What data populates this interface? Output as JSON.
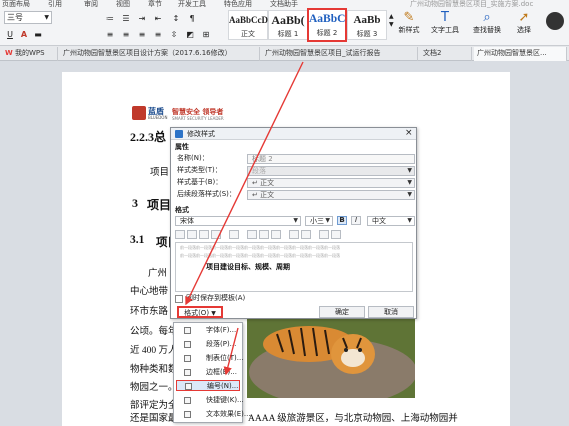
{
  "ribbon": {
    "tabs": [
      "页面布局",
      "引用",
      "审阅",
      "视图",
      "章节",
      "开发工具",
      "特色应用",
      "文档助手"
    ],
    "doc_title": "广州动物园智慧景区项目_实施方案.doc",
    "font_size_value": "三号",
    "styles": [
      {
        "preview": "AaBbCcDd",
        "label": "正文"
      },
      {
        "preview": "AaBb(",
        "label": "标题 1"
      },
      {
        "preview": "AaBbC",
        "label": "标题 2"
      },
      {
        "preview": "AaBb",
        "label": "标题 3"
      }
    ],
    "new_style_label": "新样式",
    "text_tools_label": "文字工具",
    "find_replace_label": "查找替换",
    "select_label": "选择"
  },
  "doc_tabs": [
    "我的WPS",
    "广州动物园智慧景区项目设计方案（2017.6.16修改）",
    "广州动物园智慧景区项目_试运行报告",
    "文档2",
    "广州动物园智慧景区..."
  ],
  "document": {
    "brand_name": "蓝盾",
    "brand_sub": "BLUEDON",
    "slogan": "智慧安全 领导者",
    "slogan_sub": "SMART SECURITY LEADER",
    "h_223": "2.2.3总",
    "p_project": "项目",
    "h_3": "3",
    "h_3_text": "项目",
    "h_31": "3.1",
    "h_31_text": "项目",
    "lines": [
      "广州",
      "中心地带",
      "环市东路",
      "公顷。每年",
      "近 400 万人",
      "物种类和数",
      "物园之一。",
      "部评定为全",
      "还是国家最"
    ],
    "bottom_tail": "AAAA 级旅游景区，与北京动物园、上海动物园并"
  },
  "dialog": {
    "title": "修改样式",
    "section_props": "属性",
    "name_label": "名称(N)：",
    "name_value": "标题 2",
    "type_label": "样式类型(T)：",
    "type_value": "段落",
    "based_label": "样式基于(B)：",
    "based_value": "↵ 正文",
    "next_label": "后续段落样式(S)：",
    "next_value": "↵ 正文",
    "section_format": "格式",
    "font_value": "宋体",
    "size_value": "小三",
    "bold": "B",
    "italic": "I",
    "lang_value": "中文",
    "preview_sample": "前一段落前一段落前一段落前一段落前一段落前一段落前一段落前一段落前一段落前一段落",
    "preview_text": "项目建设目标、规模、周期",
    "add_to_template": "同时保存到模板(A)",
    "format_btn": "格式(O)",
    "ok": "确定",
    "cancel": "取消"
  },
  "format_menu": {
    "items": [
      "字体(F)...",
      "段落(P)...",
      "制表位(T)...",
      "边框(B)...",
      "编号(N)...",
      "快捷键(K)...",
      "文本效果(E)..."
    ],
    "highlighted_index": 4
  },
  "colors": {
    "accent": "#1f5fbf",
    "annotation": "#e53935",
    "highlight": "#dbe8f8"
  }
}
